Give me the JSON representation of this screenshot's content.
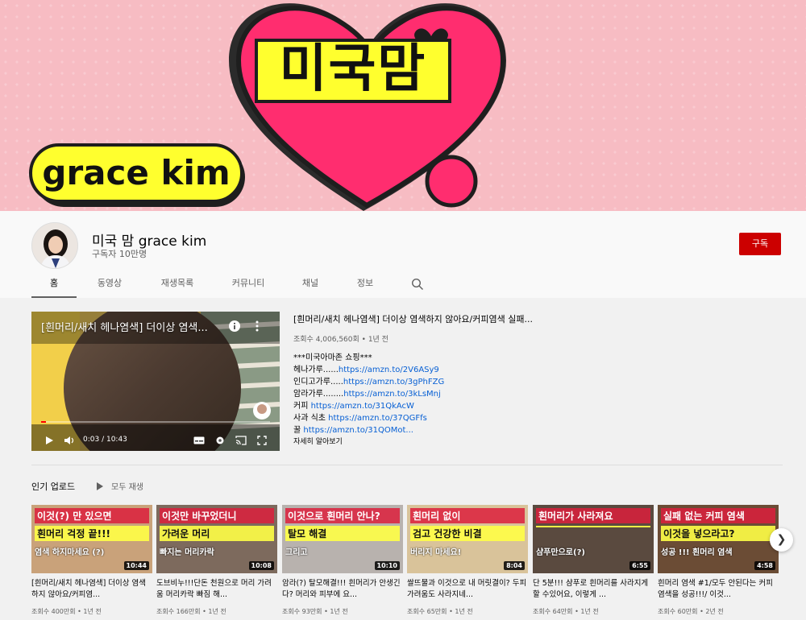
{
  "banner": {
    "title": "미국맘",
    "subtitle": "grace kim"
  },
  "channel": {
    "name": "미국 맘 grace kim",
    "subscribers": "구독자 10만명",
    "subscribe_label": "구독"
  },
  "tabs": [
    "홈",
    "동영상",
    "재생목록",
    "커뮤니티",
    "채널",
    "정보"
  ],
  "featured": {
    "overlay_title": "[흰머리/새치 헤나염색] 더이상 염색...",
    "title": "[흰머리/새치 헤나염색] 더이상 염색하지 않아요/커피염색 실패...",
    "meta": "조회수 4,006,560회 • 1년 전",
    "time": "0:03 / 10:43",
    "desc_header": "***미국아마존 쇼핑***",
    "desc_lines": [
      {
        "label": "헤나가루......",
        "link": "https://amzn.to/2V6ASy9"
      },
      {
        "label": "인디고가루.....",
        "link": "https://amzn.to/3gPhFZG"
      },
      {
        "label": "암라가루........",
        "link": "https://amzn.to/3kLsMnj"
      },
      {
        "label": "커피 ",
        "link": "https://amzn.to/31QkAcW"
      },
      {
        "label": "사과 식초 ",
        "link": "https://amzn.to/37QGFfs"
      },
      {
        "label": "꿀 ",
        "link": "https://amzn.to/31QOMot..."
      }
    ],
    "more": "자세히 알아보기"
  },
  "popular": {
    "title": "인기 업로드",
    "play_all": "모두 재생",
    "cards": [
      {
        "thumb_top": "이것(?) 만 있으면",
        "thumb_mid": "흰머리 걱정 끝!!!",
        "thumb_bot": "염색 하지마세요 (?)",
        "duration": "10:44",
        "title": "[흰머리/새치 헤나염색] 더이상 염색하지 않아요/커피염...",
        "meta": "조회수 400만회 • 1년 전",
        "bg": "#c9a27a"
      },
      {
        "thumb_top": "이것만 바꾸었더니",
        "thumb_mid": "가려운 머리",
        "thumb_bot": "빠지는 머리카락",
        "duration": "10:08",
        "title": "도브비누!!!단돈 천원으로 머리 가려움 머리카락 빠짐 해...",
        "meta": "조회수 166만회 • 1년 전",
        "bg": "#7d6a5d"
      },
      {
        "thumb_top": "이것으로 흰머리 안나?",
        "thumb_mid": "탈모 해결",
        "thumb_bot": "그리고",
        "duration": "10:10",
        "title": "암라(?) 탈모해결!!! 흰머리가 안생긴다? 머리와 피부에 요...",
        "meta": "조회수 93만회 • 1년 전",
        "bg": "#b8b2ae"
      },
      {
        "thumb_top": "흰머리 없이",
        "thumb_mid": "검고 건강한 비결",
        "thumb_bot": "버리지 마세요!",
        "duration": "8:04",
        "title": "쌀뜨물과 이것으로 내 머릿결이? 두피가려움도 사라지네...",
        "meta": "조회수 65만회 • 1년 전",
        "bg": "#d9c39a"
      },
      {
        "thumb_top": "흰머리가 사라져요",
        "thumb_mid": "",
        "thumb_bot": "샴푸만으로(?)",
        "duration": "6:55",
        "title": "단 5분!!! 샴푸로 흰머리를 사라지게 할 수있어요, 이렇게 ...",
        "meta": "조회수 64만회 • 1년 전",
        "bg": "#5a4a3f"
      },
      {
        "thumb_top": "실패 없는 커피 염색",
        "thumb_mid": "이것을 넣으라고?",
        "thumb_bot": "성공 !!! 흰머리 염색",
        "duration": "4:58",
        "title": "흰머리 염색 #1/모두 안된다는 커피 염색을 성공!!!/ 이것...",
        "meta": "조회수 60만회 • 2년 전",
        "bg": "#6b4c35"
      }
    ]
  },
  "colors": {
    "banner_pink": "#f7bcc3",
    "heart": "#ff2d6f",
    "logo_yellow": "#ffff2e",
    "subscribe_red": "#cc0000",
    "link_blue": "#065fd4"
  }
}
